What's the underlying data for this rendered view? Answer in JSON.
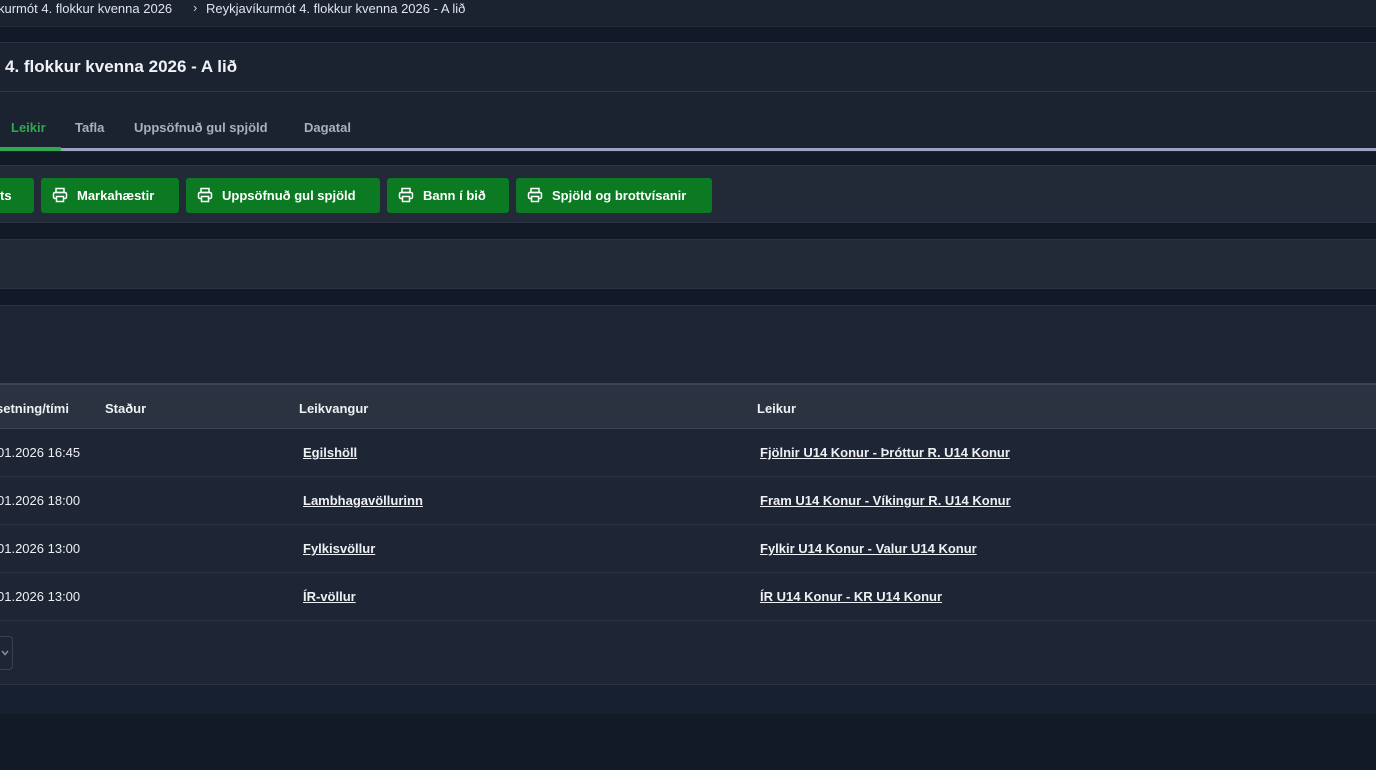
{
  "breadcrumb": {
    "items": [
      "kurmót 4. flokkur kvenna 2026",
      "Reykjavíkurmót 4. flokkur kvenna 2026 - A lið"
    ],
    "separator": "›"
  },
  "header": {
    "title": "4. flokkur kvenna 2026 - A lið"
  },
  "tabs": [
    {
      "label": "Leikir",
      "active": true
    },
    {
      "label": "Tafla",
      "active": false
    },
    {
      "label": "Uppsöfnuð gul spjöld",
      "active": false
    },
    {
      "label": "Dagatal",
      "active": false
    }
  ],
  "toolbar": {
    "buttons": [
      {
        "label": "ts",
        "icon": "printer-icon"
      },
      {
        "label": "Markahæstir",
        "icon": "printer-icon"
      },
      {
        "label": "Uppsöfnuð gul spjöld",
        "icon": "printer-icon"
      },
      {
        "label": "Bann í bið",
        "icon": "printer-icon"
      },
      {
        "label": "Spjöld og brottvísanir",
        "icon": "printer-icon"
      }
    ]
  },
  "table": {
    "headers": [
      "setning/tími",
      "Staður",
      "Leikvangur",
      "Leikur"
    ],
    "rows": [
      {
        "datetime": "01.2026 16:45",
        "place": "",
        "venue": "Egilshöll",
        "match": "Fjölnir U14 Konur - Þróttur R. U14 Konur"
      },
      {
        "datetime": "01.2026 18:00",
        "place": "",
        "venue": "Lambhagavöllurinn",
        "match": "Fram U14 Konur - Víkingur R. U14 Konur"
      },
      {
        "datetime": "01.2026 13:00",
        "place": "",
        "venue": "Fylkisvöllur",
        "match": "Fylkir U14 Konur - Valur U14 Konur"
      },
      {
        "datetime": "01.2026 13:00",
        "place": "",
        "venue": "ÍR-völlur",
        "match": "ÍR U14 Konur - KR U14 Konur"
      }
    ]
  },
  "colors": {
    "accent": "#2fa84f",
    "button": "#0b7a22",
    "background": "#131a27"
  }
}
